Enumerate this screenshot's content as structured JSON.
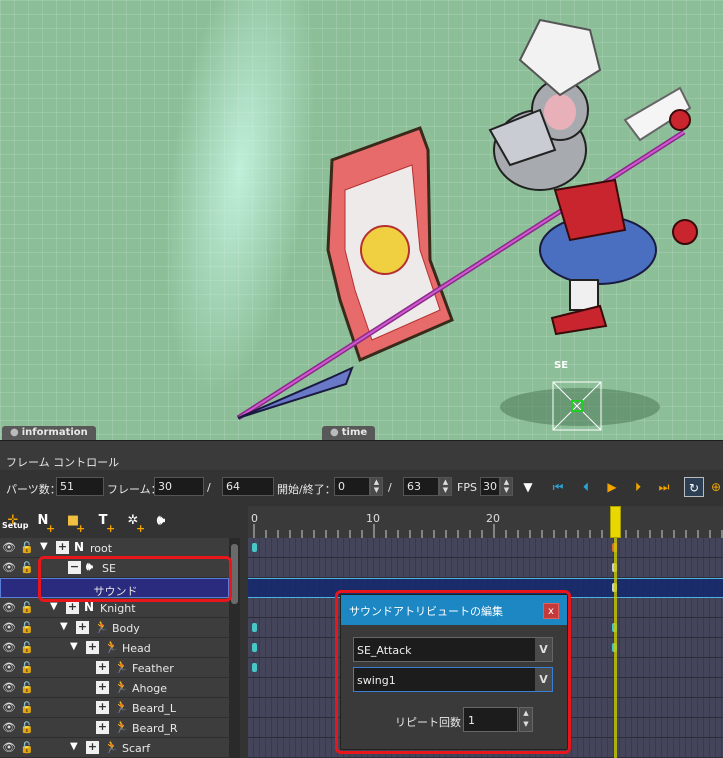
{
  "viewport": {
    "tabs": [
      "information",
      "time"
    ],
    "se_marker_label": "SE"
  },
  "panel": {
    "title": "フレーム コントロール",
    "controls": {
      "parts_label": "パーツ数：",
      "parts_value": "51",
      "frame_label": "フレーム：",
      "frame_value": "30",
      "frame_sep": "/",
      "frame_total": "64",
      "range_label": "開始/終了：",
      "start_value": "0",
      "range_sep": "/",
      "end_value": "63",
      "fps_label": "FPS",
      "fps_value": "30"
    },
    "tools": {
      "setup_label": "Setup"
    },
    "tree": [
      {
        "name": "root",
        "type": "N",
        "expand": "▼",
        "box": "+",
        "indent": 0
      },
      {
        "name": "SE",
        "type": "sound",
        "expand": "",
        "box": "−",
        "indent": 1
      },
      {
        "name": "サウンド",
        "type": "attr",
        "selected": true
      },
      {
        "name": "Knight",
        "type": "N",
        "expand": "▼",
        "box": "+",
        "indent": 1
      },
      {
        "name": "Body",
        "type": "bone",
        "expand": "▼",
        "box": "+",
        "indent": 2
      },
      {
        "name": "Head",
        "type": "bone",
        "expand": "▼",
        "box": "+",
        "indent": 3
      },
      {
        "name": "Feather",
        "type": "bone",
        "expand": "",
        "box": "+",
        "indent": 4
      },
      {
        "name": "Ahoge",
        "type": "bone",
        "expand": "",
        "box": "+",
        "indent": 4
      },
      {
        "name": "Beard_L",
        "type": "bone",
        "expand": "",
        "box": "+",
        "indent": 4
      },
      {
        "name": "Beard_R",
        "type": "bone",
        "expand": "",
        "box": "+",
        "indent": 4
      },
      {
        "name": "Scarf",
        "type": "bone",
        "expand": "▼",
        "box": "+",
        "indent": 3
      }
    ],
    "timeline": {
      "ticks": [
        "0",
        "10",
        "20"
      ],
      "current_frame": 30
    }
  },
  "dialog": {
    "title": "サウンドアトリビュートの編集",
    "close_label": "x",
    "sound_set": "SE_Attack",
    "sound_name": "swing1",
    "dropdown_arrow": "V",
    "repeat_label": "リピート回数",
    "repeat_value": "1"
  },
  "colors": {
    "accent": "#1d87c4",
    "highlight_red": "#e8161a",
    "playhead": "#e8d800",
    "key": "#48c7c7"
  }
}
